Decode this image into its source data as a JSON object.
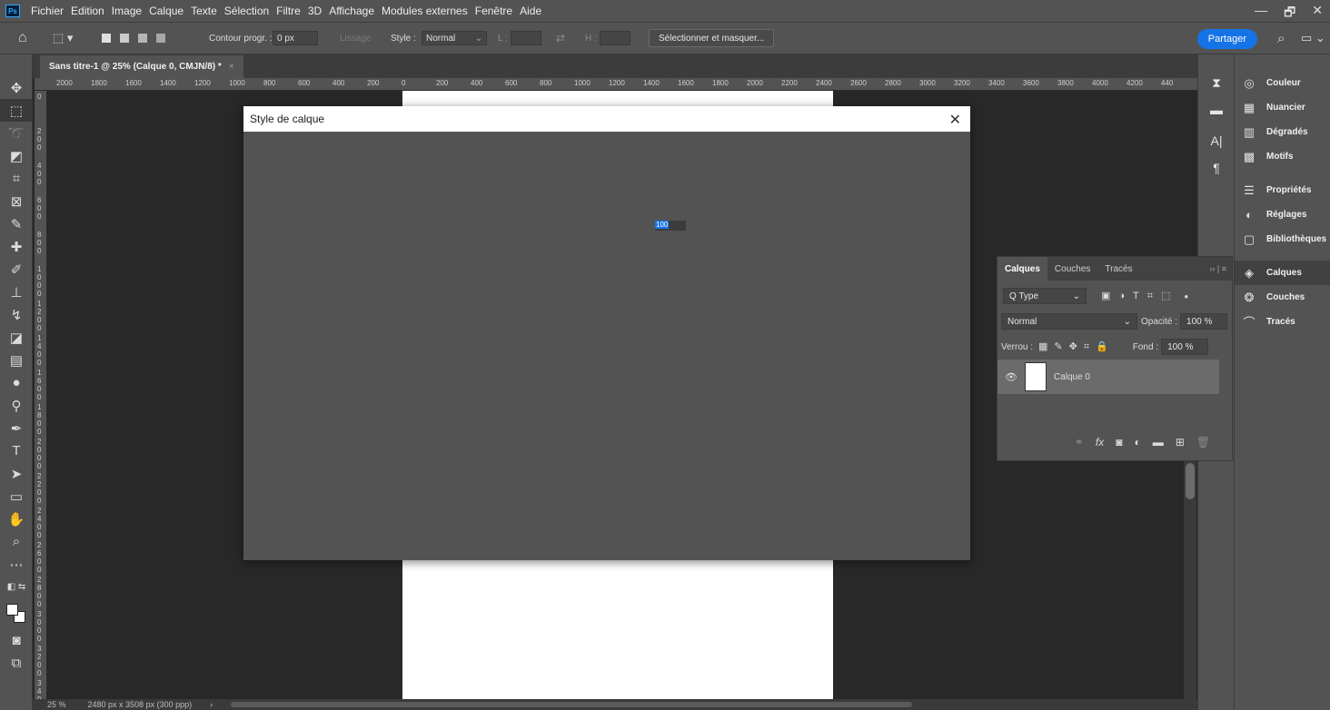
{
  "menu": [
    "Fichier",
    "Edition",
    "Image",
    "Calque",
    "Texte",
    "Sélection",
    "Filtre",
    "3D",
    "Affichage",
    "Modules externes",
    "Fenêtre",
    "Aide"
  ],
  "app_logo": "Ps",
  "window_controls": [
    "—",
    "🗗",
    "✕"
  ],
  "options": {
    "contour_label": "Contour progr. :",
    "contour_value": "0 px",
    "lissage_label": "Lissage",
    "style_label": "Style :",
    "style_value": "Normal",
    "l_label": "L :",
    "h_label": "H :",
    "select_mask_button": "Sélectionner et masquer...",
    "share_button": "Partager"
  },
  "document": {
    "tab_title": "Sans titre-1 @ 25% (Calque 0, CMJN/8) *",
    "zoom": "25 %",
    "size_info": "2480 px x 3508 px (300 ppp)"
  },
  "ruler_h": [
    "2000",
    "1800",
    "1600",
    "1400",
    "1200",
    "1000",
    "800",
    "600",
    "400",
    "200",
    "0",
    "200",
    "400",
    "600",
    "800",
    "1000",
    "1200",
    "1400",
    "1600",
    "1800",
    "2000",
    "2200",
    "2400",
    "2600",
    "2800",
    "3000",
    "3200",
    "3400",
    "3600",
    "3800",
    "4000",
    "4200",
    "440"
  ],
  "ruler_v": [
    "0",
    "2 0 0",
    "4 0 0",
    "6 0 0",
    "8 0 0",
    "1 0 0 0",
    "1 2 0 0",
    "1 4 0 0",
    "1 6 0 0",
    "1 8 0 0",
    "2 0 0 0",
    "2 2 0 0",
    "2 4 0 0",
    "2 6 0 0",
    "2 8 0 0",
    "3 0 0 0",
    "3 2 0 0",
    "3 4 0 0"
  ],
  "dialog": {
    "title": "Style de calque",
    "close": "✕",
    "input_value": "100"
  },
  "layers_panel": {
    "tabs": [
      "Calques",
      "Couches",
      "Tracés"
    ],
    "filter_label": "Q Type",
    "blend_mode": "Normal",
    "opacity_label": "Opacité :",
    "opacity_value": "100 %",
    "lock_label": "Verrou :",
    "fill_label": "Fond :",
    "fill_value": "100 %",
    "layer_name": "Calque 0"
  },
  "right_panels": {
    "group1": [
      "Couleur",
      "Nuancier",
      "Dégradés",
      "Motifs"
    ],
    "group2": [
      "Propriétés",
      "Réglages",
      "Bibliothèques"
    ],
    "group3": [
      "Calques",
      "Couches",
      "Tracés"
    ]
  },
  "colors": {
    "accent": "#1473e6",
    "ui_bg": "#535353",
    "canvas_bg": "#282828"
  }
}
